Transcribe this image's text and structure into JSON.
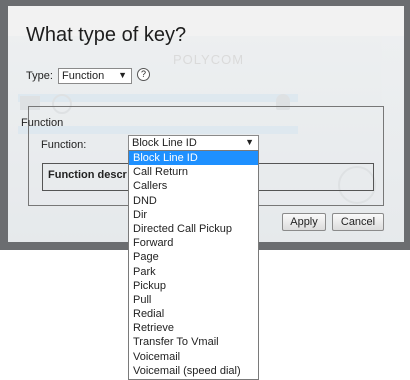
{
  "dialog": {
    "title": "What type of key?",
    "type_label": "Type:",
    "type_value": "Function",
    "help_symbol": "?",
    "fieldset_legend": "Function",
    "function_label": "Function:",
    "function_value": "Block Line ID",
    "description_label": "Function descr",
    "apply_label": "Apply",
    "cancel_label": "Cancel",
    "background_brand": "POLYCOM"
  },
  "dropdown": {
    "selected_index": 0,
    "options": [
      "Block Line ID",
      "Call Return",
      "Callers",
      "DND",
      "Dir",
      "Directed Call Pickup",
      "Forward",
      "Page",
      "Park",
      "Pickup",
      "Pull",
      "Redial",
      "Retrieve",
      "Transfer To Vmail",
      "Voicemail",
      "Voicemail (speed dial)"
    ]
  },
  "colors": {
    "frame": "#6b6d70",
    "dialog_bg": "#f2f2f2",
    "selection": "#1e90ff"
  },
  "icons": {
    "select_arrow": "▼",
    "help": "help-icon"
  }
}
